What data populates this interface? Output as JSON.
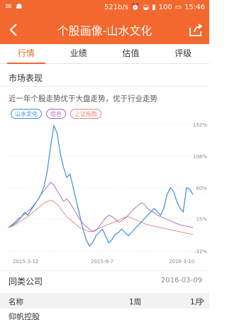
{
  "status": {
    "net_speed": "521b/s",
    "battery": "100",
    "time": "15:46"
  },
  "header": {
    "title": "个股画像-山水文化"
  },
  "tabs": [
    {
      "label": "行情",
      "active": true
    },
    {
      "label": "业绩",
      "active": false
    },
    {
      "label": "估值",
      "active": false
    },
    {
      "label": "评级",
      "active": false
    }
  ],
  "market": {
    "section_title": "市场表现",
    "description": "近一年个股走势优于大盘走势，优于行业走势"
  },
  "colors": {
    "accent": "#f2682e",
    "stock": "#3a8fd6",
    "composite": "#b05fc0",
    "shanghai": "#e98080"
  },
  "chart_data": {
    "type": "line",
    "x_ticks": [
      "2015-3-12",
      "2015-9-7",
      "2016-3-10"
    ],
    "y_ticks": [
      "152%",
      "106%",
      "60%",
      "15%",
      "-32%"
    ],
    "ylim": [
      -32,
      152
    ],
    "series": [
      {
        "name": "山水文化",
        "color": "#3a8fd6",
        "values": [
          2,
          5,
          8,
          12,
          18,
          24,
          20,
          28,
          35,
          42,
          50,
          62,
          85,
          120,
          150,
          140,
          110,
          90,
          75,
          80,
          60,
          40,
          20,
          0,
          -15,
          -25,
          -20,
          -10,
          -5,
          0,
          -10,
          -20,
          -15,
          -8,
          -5,
          0,
          -5,
          -10,
          -5,
          0,
          5,
          10,
          15,
          20,
          25,
          30,
          25,
          20,
          30,
          50,
          60,
          55,
          40,
          30,
          25,
          60,
          58,
          50
        ]
      },
      {
        "name": "综合",
        "color": "#b05fc0",
        "values": [
          2,
          6,
          10,
          15,
          18,
          22,
          26,
          30,
          36,
          42,
          50,
          56,
          62,
          68,
          64,
          56,
          48,
          40,
          44,
          38,
          30,
          22,
          14,
          8,
          4,
          0,
          -4,
          -2,
          4,
          10,
          16,
          20,
          18,
          14,
          10,
          12,
          16,
          20,
          26,
          30,
          34,
          38,
          36,
          30,
          26,
          24,
          20,
          18,
          16,
          14,
          12,
          10,
          8,
          6,
          5,
          4,
          3,
          2
        ]
      },
      {
        "name": "上证指数",
        "color": "#e98080",
        "values": [
          2,
          4,
          6,
          9,
          12,
          15,
          18,
          22,
          26,
          30,
          34,
          38,
          40,
          42,
          40,
          36,
          30,
          24,
          18,
          14,
          10,
          6,
          2,
          0,
          -2,
          -4,
          -3,
          -1,
          1,
          3,
          5,
          7,
          9,
          11,
          13,
          15,
          17,
          18,
          16,
          14,
          12,
          10,
          8,
          6,
          5,
          4,
          3,
          2,
          1,
          0,
          -1,
          -2,
          -3,
          -4,
          -5,
          -6,
          -7,
          -8
        ]
      }
    ]
  },
  "peers": {
    "title": "同类公司",
    "date": "2016-03-09",
    "columns": [
      "名称",
      "1周",
      "1月"
    ]
  },
  "sections": {
    "next_title": "仰帆控股"
  }
}
